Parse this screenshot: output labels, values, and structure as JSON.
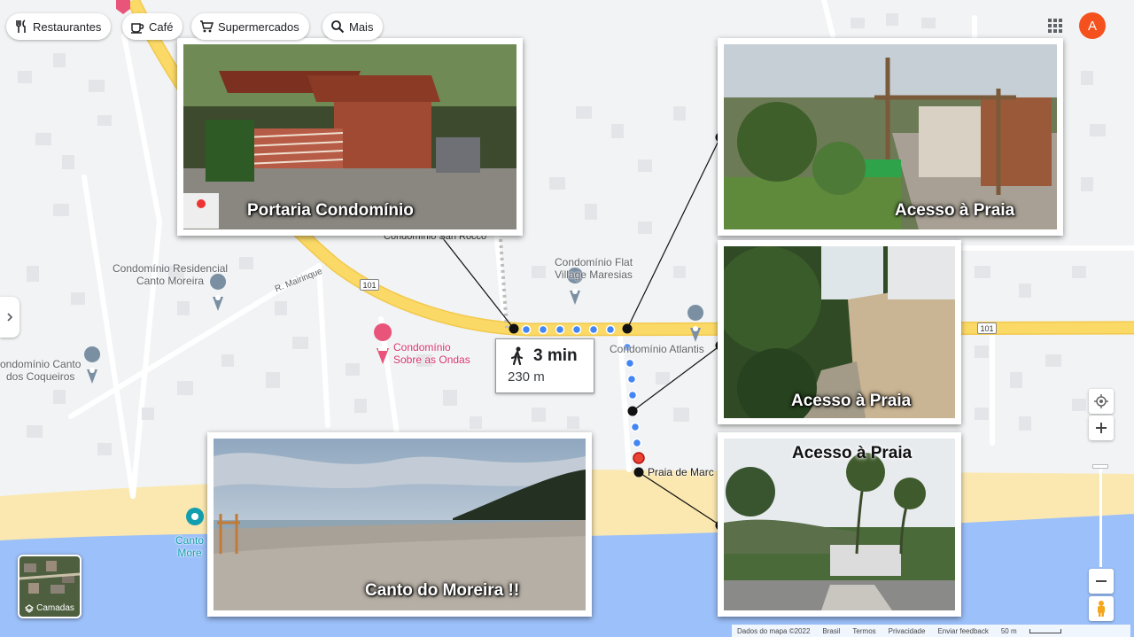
{
  "chips": [
    {
      "label": "Restaurantes",
      "icon": "fork-knife-icon"
    },
    {
      "label": "Café",
      "icon": "coffee-cup-icon"
    },
    {
      "label": "Supermercados",
      "icon": "shopping-cart-icon"
    },
    {
      "label": "Mais",
      "icon": "search-icon"
    }
  ],
  "account": {
    "initial": "A",
    "color": "#f4511e"
  },
  "route": {
    "duration": "3 min",
    "distance": "230 m",
    "mode_icon": "walking-person-icon",
    "color": "#4285f4"
  },
  "places": {
    "cond_residencial": "Condomínio Residencial\nCanto Moreira",
    "cond_flat": "Condomínio Flat\nVillage Maresias",
    "cond_sobre": "Condomínio\nSobre as Ondas",
    "cond_atlantis": "Condomínio Atlantis",
    "cond_canto": "ondomínio Canto\ndos Coqueiros",
    "praia": "Praia de Marc",
    "canto_label": "Canto\nMore",
    "cond_san": "Condomínio San Rocco"
  },
  "roads": {
    "r_mairinque": "R. Mairinque",
    "shield_101": "101"
  },
  "photos": {
    "portaria": "Portaria Condomínio",
    "acesso_1": "Acesso à Praia",
    "acesso_2": "Acesso à Praia",
    "acesso_3": "Acesso à Praia",
    "canto": "Canto do Moreira !!"
  },
  "layers": {
    "label": "Camadas"
  },
  "footer": {
    "data": "Dados do mapa ©2022",
    "country": "Brasil",
    "terms": "Termos",
    "privacy": "Privacidade",
    "feedback": "Enviar feedback",
    "scale": "50 m"
  },
  "colors": {
    "road_main": "#fbd967",
    "sea": "#9cc0f9",
    "sand": "#fbe8b0",
    "land": "#f1f3f4"
  }
}
